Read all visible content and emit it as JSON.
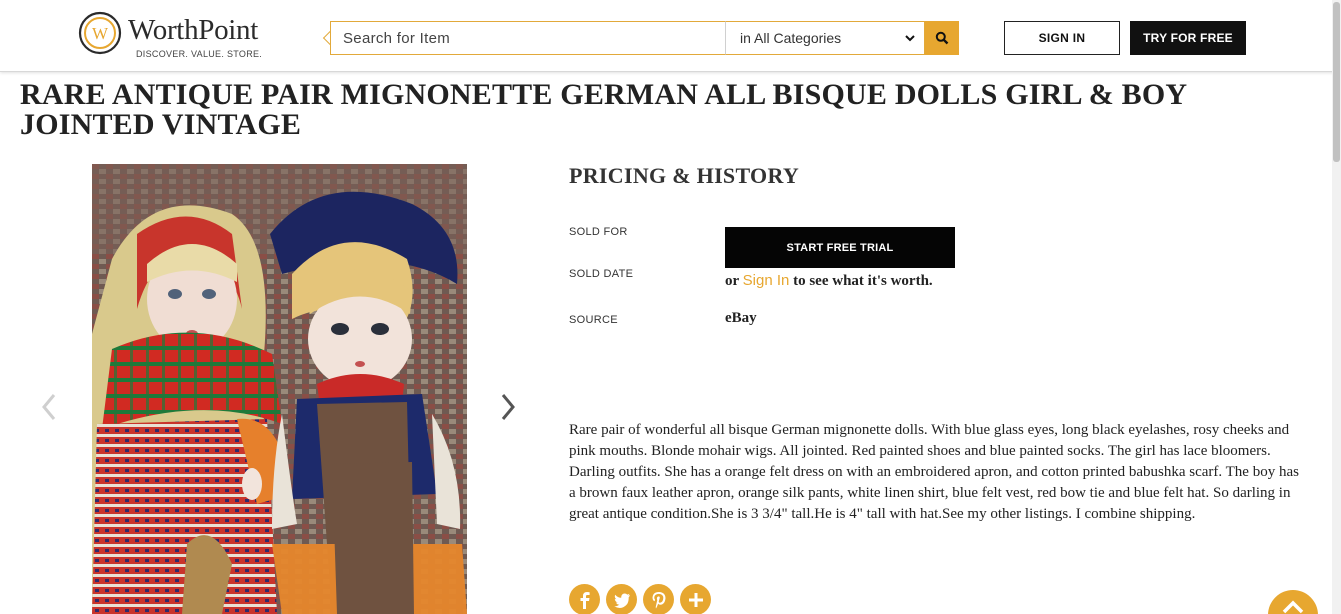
{
  "brand": {
    "name": "WorthPoint",
    "tagline": "DISCOVER. VALUE. STORE.",
    "accent": "#e7a730",
    "logo_letter": "W"
  },
  "header": {
    "search_placeholder": "Search for Item",
    "category_selected": "in All Categories",
    "search_icon": "search-icon",
    "signin_label": "SIGN IN",
    "try_label": "TRY FOR FREE"
  },
  "item": {
    "title": "RARE ANTIQUE PAIR MIGNONETTE GERMAN ALL BISQUE DOLLS GIRL & BOY JOINTED VINTAGE"
  },
  "gallery": {
    "prev_icon": "chevron-left-icon",
    "next_icon": "chevron-right-icon"
  },
  "pricing": {
    "title": "PRICING & HISTORY",
    "sold_for_label": "SOLD FOR",
    "sold_date_label": "SOLD DATE",
    "source_label": "SOURCE",
    "trial_button": "START FREE TRIAL",
    "or_text": "or",
    "signin_link": "Sign In",
    "worth_text": "to see what it's worth.",
    "source_value": "eBay"
  },
  "description": "Rare pair of wonderful all bisque German mignonette dolls. With blue glass eyes, long black eyelashes, rosy cheeks and pink mouths. Blonde mohair wigs. All jointed. Red painted shoes and blue painted socks. The girl has lace bloomers. Darling outfits. She has a orange felt dress on with an embroidered apron, and cotton printed babushka scarf. The boy has a brown faux leather apron, orange silk pants, white linen shirt, blue felt vest, red bow tie and blue felt hat. So darling in great antique condition.She is 3 3/4\" tall.He is 4\" tall with hat.See my other listings. I combine shipping.",
  "social": [
    "facebook-icon",
    "twitter-icon",
    "pinterest-icon",
    "plus-icon"
  ]
}
